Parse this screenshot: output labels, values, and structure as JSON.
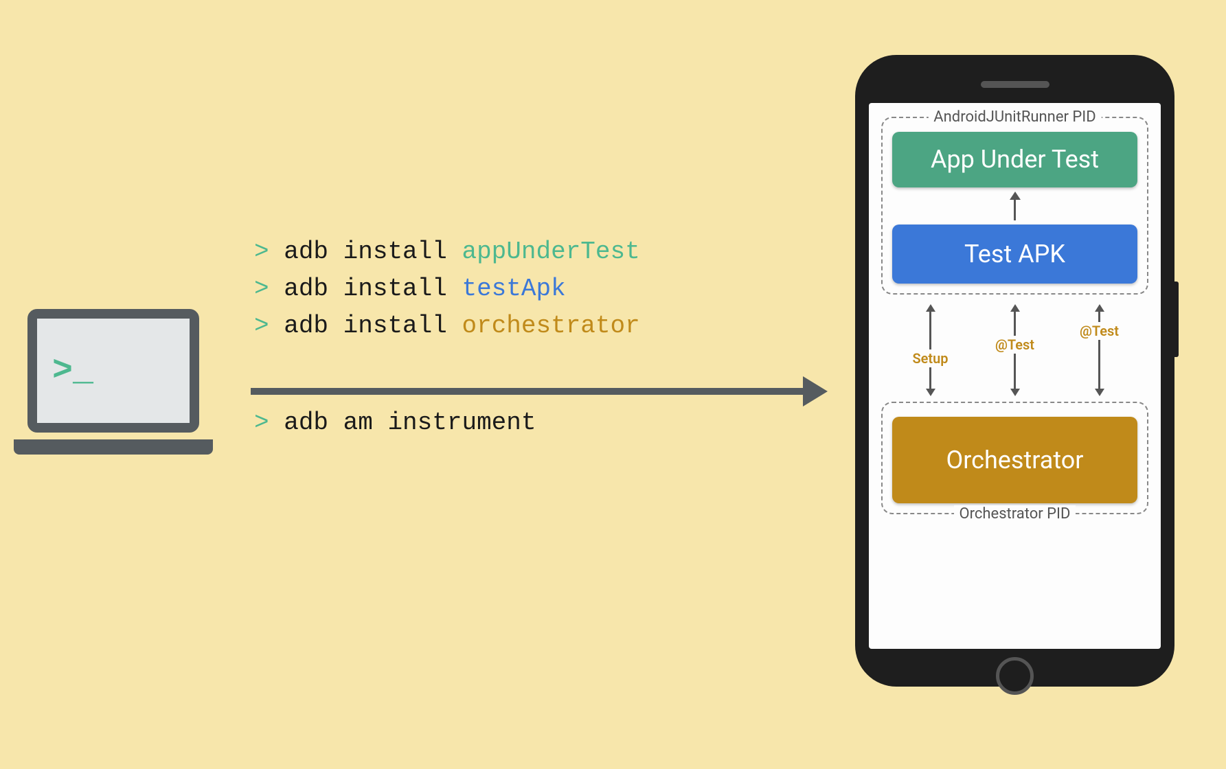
{
  "laptop": {
    "prompt": ">_"
  },
  "commands": {
    "line1": {
      "prompt": ">",
      "cmd": "adb install",
      "arg": "appUnderTest"
    },
    "line2": {
      "prompt": ">",
      "cmd": "adb install",
      "arg": "testApk"
    },
    "line3": {
      "prompt": ">",
      "cmd": "adb install",
      "arg": "orchestrator"
    },
    "line4": {
      "prompt": ">",
      "cmd": "adb am instrument"
    }
  },
  "phone": {
    "pid1_label": "AndroidJUnitRunner PID",
    "box_app": "App Under Test",
    "box_test": "Test APK",
    "conn_labels": {
      "setup": "Setup",
      "test1": "@Test",
      "test2": "@Test"
    },
    "box_orch": "Orchestrator",
    "pid2_label": "Orchestrator PID"
  }
}
